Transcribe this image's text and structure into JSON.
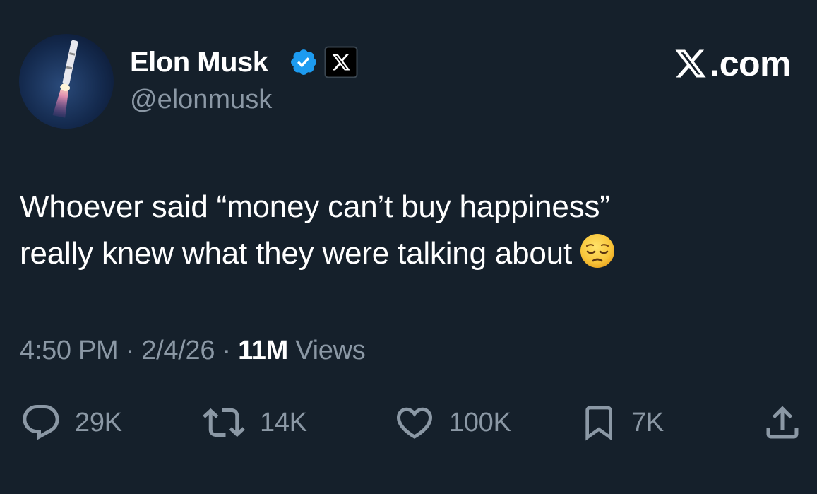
{
  "author": {
    "display_name": "Elon Musk",
    "handle": "@elonmusk",
    "avatar": "rocket-launch-avatar",
    "verified_icon": "verified-badge-icon",
    "affiliation_icon": "x-logo-icon"
  },
  "brand": {
    "logo_text": ".com",
    "logo_icon": "x-logo-icon"
  },
  "tweet": {
    "line1": "Whoever said “money can’t buy happiness”",
    "line2": "really knew what they were talking about",
    "emoji": "pensive-face-emoji"
  },
  "meta": {
    "time": "4:50 PM",
    "sep1": "·",
    "date": "2/4/26",
    "sep2": "·",
    "views_count": "11M",
    "views_label": "Views"
  },
  "actions": {
    "reply": {
      "icon": "reply-icon",
      "count": "29K"
    },
    "repost": {
      "icon": "repost-icon",
      "count": "14K"
    },
    "like": {
      "icon": "heart-icon",
      "count": "100K"
    },
    "bookmark": {
      "icon": "bookmark-icon",
      "count": "7K"
    },
    "share": {
      "icon": "share-icon"
    }
  },
  "colors": {
    "background": "#15202b",
    "primary_text": "#ffffff",
    "secondary_text": "#8b98a5",
    "verified_blue": "#1d9bf0"
  }
}
